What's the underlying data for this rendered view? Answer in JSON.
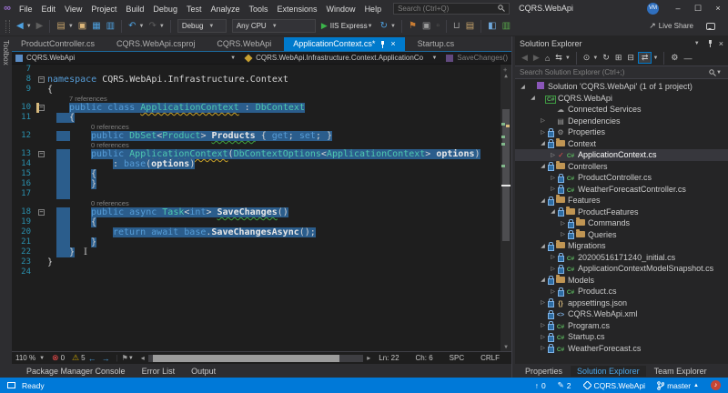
{
  "titlebar": {
    "menus": [
      "File",
      "Edit",
      "View",
      "Project",
      "Build",
      "Debug",
      "Test",
      "Analyze",
      "Tools",
      "Extensions",
      "Window",
      "Help"
    ],
    "search_placeholder": "Search (Ctrl+Q)",
    "window_title": "CQRS.WebApi",
    "avatar": "VM",
    "minimize": "–",
    "maximize": "☐",
    "close": "×"
  },
  "toolbar": {
    "debug_config": "Debug",
    "platform": "Any CPU",
    "run_target": "IIS Express",
    "live_share": "Live Share",
    "items": [
      {
        "type": "icon",
        "name": "nav-back-icon",
        "glyph": "◀",
        "color": "#4ea1e0",
        "caret": true
      },
      {
        "type": "icon",
        "name": "nav-forward-icon",
        "glyph": "▶",
        "color": "#5e5e5e"
      },
      {
        "type": "sep"
      },
      {
        "type": "icon",
        "name": "new-project-icon",
        "glyph": "▤",
        "color": "#c8a46b",
        "caret": true
      },
      {
        "type": "icon",
        "name": "open-folder-icon",
        "glyph": "▣",
        "color": "#dcb67a"
      },
      {
        "type": "icon",
        "name": "save-icon",
        "glyph": "▦",
        "color": "#4ea1e0"
      },
      {
        "type": "icon",
        "name": "save-all-icon",
        "glyph": "▥",
        "color": "#4ea1e0"
      },
      {
        "type": "sep"
      },
      {
        "type": "icon",
        "name": "undo-icon",
        "glyph": "↶",
        "color": "#4ea1e0",
        "caret": true
      },
      {
        "type": "icon",
        "name": "redo-icon",
        "glyph": "↷",
        "color": "#5e5e5e",
        "caret": true
      },
      {
        "type": "sep"
      },
      {
        "type": "combo",
        "name": "debug-config-select",
        "bind": "debug_config"
      },
      {
        "type": "combo",
        "name": "platform-select",
        "bind": "platform"
      },
      {
        "type": "run"
      },
      {
        "type": "icon",
        "name": "restart-icon",
        "glyph": "↻",
        "color": "#4ea1e0",
        "caret": true
      },
      {
        "type": "sep"
      },
      {
        "type": "icon",
        "name": "find-in-files-icon",
        "glyph": "⚑",
        "color": "#c87c33"
      },
      {
        "type": "icon",
        "name": "live-visual-tree-icon",
        "glyph": "▣",
        "color": "#9b9b9b"
      },
      {
        "type": "icon",
        "name": "extra-tool-icon",
        "glyph": "▫",
        "color": "#5e5e5e"
      },
      {
        "type": "sep"
      },
      {
        "type": "icon",
        "name": "new-item-icon",
        "glyph": "⊔",
        "color": "#9b9b9b"
      },
      {
        "type": "icon",
        "name": "filter-icon",
        "glyph": "▤",
        "color": "#c8a46b"
      },
      {
        "type": "sep"
      },
      {
        "type": "icon",
        "name": "attach-process-icon",
        "glyph": "◧",
        "color": "#6fa8dc"
      },
      {
        "type": "icon",
        "name": "profiler-icon",
        "glyph": "▥",
        "color": "#57a64a"
      }
    ]
  },
  "tabs": [
    {
      "label": "ProductController.cs",
      "active": false
    },
    {
      "label": "CQRS.WebApi.csproj",
      "active": false
    },
    {
      "label": "CQRS.WebApi",
      "active": false
    },
    {
      "label": "ApplicationContext.cs*",
      "active": true
    },
    {
      "label": "Startup.cs",
      "active": false
    }
  ],
  "breadcrumb": {
    "project": "CQRS.WebApi",
    "type_path": "CQRS.WebApi.Infrastructure.Context.ApplicationCo",
    "member": "SaveChanges()"
  },
  "editor": {
    "zoom": "110 %",
    "errors": "0",
    "warnings": "5",
    "line_info": "Ln: 22",
    "col_info": "Ch: 6",
    "space_mode": "SPC",
    "eol": "CRLF",
    "lines": [
      {
        "n": "7",
        "indent": 0,
        "tokens": []
      },
      {
        "n": "8",
        "fold": true,
        "indent": 0,
        "tokens": [
          [
            "k",
            "namespace "
          ],
          [
            "p",
            "CQRS.WebApi.Infrastructure.Context"
          ]
        ]
      },
      {
        "n": "9",
        "indent": 0,
        "tokens": [
          [
            "p",
            "{"
          ]
        ]
      },
      {
        "cl": "7 references",
        "indent": 4
      },
      {
        "n": "10",
        "fold": true,
        "sel": true,
        "change": true,
        "indent": 4,
        "tokens": [
          [
            "k",
            "public class "
          ],
          [
            "ty",
            "ApplicationContext"
          ],
          [
            "p",
            " : "
          ],
          [
            "t",
            "DbContext"
          ]
        ]
      },
      {
        "n": "11",
        "sel": true,
        "strip": true,
        "indent": 4,
        "tokens": [
          [
            "p",
            "{"
          ]
        ]
      },
      {
        "cl": "0 references",
        "indent": 8
      },
      {
        "n": "12",
        "sel": true,
        "strip": true,
        "indent": 8,
        "tokens": [
          [
            "k",
            "public "
          ],
          [
            "t",
            "DbSet"
          ],
          [
            "p",
            "<"
          ],
          [
            "t",
            "Product"
          ],
          [
            "p",
            "> "
          ],
          [
            "mg",
            "Products"
          ],
          [
            "p",
            " { "
          ],
          [
            "k",
            "get"
          ],
          [
            "p",
            "; "
          ],
          [
            "k",
            "set"
          ],
          [
            "p",
            "; }"
          ]
        ]
      },
      {
        "cl": "0 references",
        "indent": 8
      },
      {
        "n": "13",
        "fold": true,
        "sel": true,
        "strip": true,
        "indent": 8,
        "tokens": [
          [
            "k",
            "public "
          ],
          [
            "ty",
            "ApplicationContext"
          ],
          [
            "p",
            "("
          ],
          [
            "t",
            "DbContextOptions"
          ],
          [
            "p",
            "<"
          ],
          [
            "t",
            "ApplicationContext"
          ],
          [
            "p",
            "> "
          ],
          [
            "m",
            "options"
          ],
          [
            "p",
            ")"
          ]
        ]
      },
      {
        "n": "14",
        "sel": true,
        "strip": true,
        "indent": 12,
        "tokens": [
          [
            "p",
            ": "
          ],
          [
            "k",
            "base"
          ],
          [
            "p",
            "("
          ],
          [
            "m",
            "options"
          ],
          [
            "p",
            ")"
          ]
        ]
      },
      {
        "n": "15",
        "sel": true,
        "strip": true,
        "indent": 8,
        "tokens": [
          [
            "p",
            "{"
          ]
        ]
      },
      {
        "n": "16",
        "sel": true,
        "strip": true,
        "indent": 8,
        "tokens": [
          [
            "p",
            "}"
          ]
        ]
      },
      {
        "n": "17",
        "strip": true,
        "indent": 8,
        "tokens": []
      },
      {
        "cl": "0 references",
        "indent": 8
      },
      {
        "n": "18",
        "fold": true,
        "sel": true,
        "strip": true,
        "indent": 8,
        "tokens": [
          [
            "k",
            "public async "
          ],
          [
            "t",
            "Task"
          ],
          [
            "p",
            "<"
          ],
          [
            "k",
            "int"
          ],
          [
            "p",
            "> "
          ],
          [
            "mg",
            "SaveChanges"
          ],
          [
            "p",
            "()"
          ]
        ]
      },
      {
        "n": "19",
        "sel": true,
        "strip": true,
        "indent": 8,
        "tokens": [
          [
            "p",
            "{"
          ]
        ]
      },
      {
        "n": "20",
        "sel": true,
        "strip": true,
        "indent": 12,
        "tokens": [
          [
            "k",
            "return "
          ],
          [
            "k",
            "await "
          ],
          [
            "k",
            "base"
          ],
          [
            "p",
            "."
          ],
          [
            "m",
            "SaveChangesAsync"
          ],
          [
            "p",
            "();"
          ]
        ]
      },
      {
        "n": "21",
        "sel": true,
        "strip": true,
        "indent": 8,
        "tokens": [
          [
            "p",
            "}"
          ]
        ]
      },
      {
        "n": "22",
        "sel": true,
        "strip": true,
        "indent": 4,
        "tokens": [
          [
            "p",
            "}"
          ]
        ],
        "cursor": true
      },
      {
        "n": "23",
        "indent": 0,
        "tokens": [
          [
            "p",
            "}"
          ]
        ]
      },
      {
        "n": "24",
        "indent": 0,
        "tokens": []
      }
    ]
  },
  "panel_tabs": [
    "Package Manager Console",
    "Error List",
    "Output"
  ],
  "solution_explorer": {
    "title": "Solution Explorer",
    "search_placeholder": "Search Solution Explorer (Ctrl+;)",
    "toolbar": [
      {
        "name": "se-back-icon",
        "glyph": "◀",
        "dim": true
      },
      {
        "name": "se-forward-icon",
        "glyph": "▶",
        "dim": true
      },
      {
        "name": "se-home-icon",
        "glyph": "⌂"
      },
      {
        "name": "se-switch-views-icon",
        "glyph": "⇆",
        "caret": true
      },
      {
        "name": "sep"
      },
      {
        "name": "se-pending-changes-filter-icon",
        "glyph": "⊙",
        "caret": true
      },
      {
        "name": "se-refresh-icon",
        "glyph": "↻"
      },
      {
        "name": "se-show-all-files-icon",
        "glyph": "⊞"
      },
      {
        "name": "se-collapse-all-icon",
        "glyph": "⊟"
      },
      {
        "name": "se-sync-active-document-icon",
        "glyph": "⇄",
        "hl": true,
        "caret": true
      },
      {
        "name": "sep"
      },
      {
        "name": "se-properties-icon",
        "glyph": "⚙"
      },
      {
        "name": "se-preview-icon",
        "glyph": "—"
      }
    ],
    "tree": [
      {
        "label": "Solution 'CQRS.WebApi' (1 of 1 project)",
        "indent": 0,
        "arrow": "exp",
        "icon": "sln"
      },
      {
        "label": "CQRS.WebApi",
        "indent": 1,
        "arrow": "exp",
        "icon": "proj"
      },
      {
        "label": "Connected Services",
        "indent": 2,
        "arrow": "none",
        "icon": "cloud"
      },
      {
        "label": "Dependencies",
        "indent": 2,
        "arrow": "col",
        "icon": "deps"
      },
      {
        "label": "Properties",
        "indent": 2,
        "arrow": "col",
        "icon": "props",
        "lock": true
      },
      {
        "label": "Context",
        "indent": 2,
        "arrow": "exp",
        "icon": "folder",
        "lock": true
      },
      {
        "label": "ApplicationContext.cs",
        "indent": 3,
        "arrow": "col",
        "icon": "cs",
        "check": true,
        "selected": true
      },
      {
        "label": "Controllers",
        "indent": 2,
        "arrow": "exp",
        "icon": "folder",
        "lock": true
      },
      {
        "label": "ProductController.cs",
        "indent": 3,
        "arrow": "col",
        "icon": "cs",
        "lock": true
      },
      {
        "label": "WeatherForecastController.cs",
        "indent": 3,
        "arrow": "col",
        "icon": "cs",
        "lock": true
      },
      {
        "label": "Features",
        "indent": 2,
        "arrow": "exp",
        "icon": "folder",
        "lock": true
      },
      {
        "label": "ProductFeatures",
        "indent": 3,
        "arrow": "exp",
        "icon": "folder",
        "lock": true
      },
      {
        "label": "Commands",
        "indent": 4,
        "arrow": "col",
        "icon": "folder",
        "lock": true
      },
      {
        "label": "Queries",
        "indent": 4,
        "arrow": "col",
        "icon": "folder",
        "lock": true
      },
      {
        "label": "Migrations",
        "indent": 2,
        "arrow": "exp",
        "icon": "folder",
        "lock": true
      },
      {
        "label": "20200516171240_initial.cs",
        "indent": 3,
        "arrow": "col",
        "icon": "cs",
        "lock": true
      },
      {
        "label": "ApplicationContextModelSnapshot.cs",
        "indent": 3,
        "arrow": "col",
        "icon": "cs",
        "lock": true
      },
      {
        "label": "Models",
        "indent": 2,
        "arrow": "exp",
        "icon": "folder",
        "lock": true
      },
      {
        "label": "Product.cs",
        "indent": 3,
        "arrow": "col",
        "icon": "cs",
        "lock": true
      },
      {
        "label": "appsettings.json",
        "indent": 2,
        "arrow": "col",
        "icon": "json",
        "lock": true
      },
      {
        "label": "CQRS.WebApi.xml",
        "indent": 2,
        "arrow": "none",
        "icon": "xml",
        "lock": true
      },
      {
        "label": "Program.cs",
        "indent": 2,
        "arrow": "col",
        "icon": "cs",
        "lock": true
      },
      {
        "label": "Startup.cs",
        "indent": 2,
        "arrow": "col",
        "icon": "cs",
        "lock": true
      },
      {
        "label": "WeatherForecast.cs",
        "indent": 2,
        "arrow": "col",
        "icon": "cs",
        "lock": true
      }
    ],
    "bottom_tabs": [
      {
        "label": "Properties",
        "active": false
      },
      {
        "label": "Solution Explorer",
        "active": true
      },
      {
        "label": "Team Explorer",
        "active": false
      }
    ]
  },
  "statusbar": {
    "ready": "Ready",
    "push_count": "0",
    "edit_count": "2",
    "repo": "CQRS.WebApi",
    "branch": "master"
  },
  "colors": {
    "accent": "#007acc",
    "statusbar": "#0079d8",
    "selection": "#2b5d8c",
    "modified_bar": "#d7ba7d"
  }
}
